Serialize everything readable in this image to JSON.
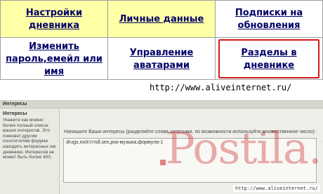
{
  "nav": {
    "row1": [
      "Настройки дневника",
      "Личные данные",
      "Подписки на обновления"
    ],
    "row2": [
      "Изменить пароль,емейл или имя",
      "Управление аватарами",
      "Разделы в дневнике"
    ],
    "highlighted": "Разделы в дневнике",
    "colors": {
      "link": "#000066",
      "row1_bg": "#ffffa6",
      "highlight_border": "#d11919"
    }
  },
  "url_top": "http://www.aliveinternet.ru/",
  "form": {
    "header": "Интересы",
    "side_title": "Интересы",
    "side_text": "Укажите как можно более полный список ваших интересов. Это поможет другим посетителям форума находить интересных им дневники. Интересов не может быть более 400.",
    "prompt": "Напишите Ваши интересы (разделяйте слова запятыми, по возможности используйте множественное число):",
    "textarea_value": "drugs,rock'n'roll,sex,рок-музыка,формула-1",
    "url_bottom": "http://www.aliveinternet.ru/"
  },
  "watermark": "Postila.ru"
}
